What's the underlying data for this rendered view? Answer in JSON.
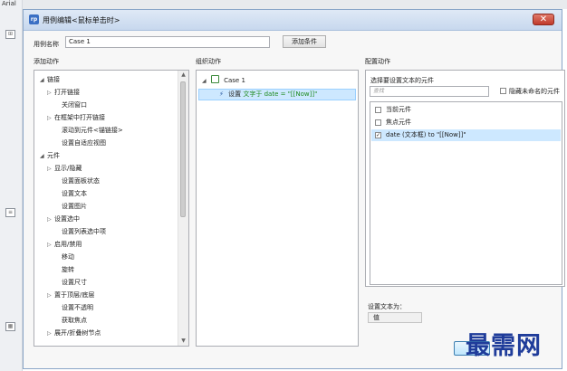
{
  "background": {
    "font_label": "Arial"
  },
  "dialog": {
    "title": "用例编辑<鼠标单击时>",
    "close_symbol": "✕",
    "case_name_label": "用例名称",
    "case_name_value": "Case 1",
    "add_condition_button": "添加条件"
  },
  "sections": {
    "add_action": "添加动作",
    "organize_actions": "组织动作",
    "configure_actions": "配置动作"
  },
  "action_tree": [
    {
      "label": "链接",
      "arrow": "◢",
      "indent": 0
    },
    {
      "label": "打开链接",
      "arrow": "▷",
      "indent": 1
    },
    {
      "label": "关闭窗口",
      "arrow": "",
      "indent": 1
    },
    {
      "label": "在框架中打开链接",
      "arrow": "▷",
      "indent": 1
    },
    {
      "label": "滚动到元件<锚链接>",
      "arrow": "",
      "indent": 1
    },
    {
      "label": "设置自适应视图",
      "arrow": "",
      "indent": 1
    },
    {
      "label": "元件",
      "arrow": "◢",
      "indent": 0
    },
    {
      "label": "显示/隐藏",
      "arrow": "▷",
      "indent": 1
    },
    {
      "label": "设置面板状态",
      "arrow": "",
      "indent": 1
    },
    {
      "label": "设置文本",
      "arrow": "",
      "indent": 1
    },
    {
      "label": "设置图片",
      "arrow": "",
      "indent": 1
    },
    {
      "label": "设置选中",
      "arrow": "▷",
      "indent": 1
    },
    {
      "label": "设置列表选中项",
      "arrow": "",
      "indent": 1
    },
    {
      "label": "启用/禁用",
      "arrow": "▷",
      "indent": 1
    },
    {
      "label": "移动",
      "arrow": "",
      "indent": 1
    },
    {
      "label": "旋转",
      "arrow": "",
      "indent": 1
    },
    {
      "label": "设置尺寸",
      "arrow": "",
      "indent": 1
    },
    {
      "label": "置于顶层/底层",
      "arrow": "▷",
      "indent": 1
    },
    {
      "label": "设置不透明",
      "arrow": "",
      "indent": 1
    },
    {
      "label": "获取焦点",
      "arrow": "",
      "indent": 1
    },
    {
      "label": "展开/折叠树节点",
      "arrow": "▷",
      "indent": 1
    }
  ],
  "organize": {
    "case_arrow": "◢",
    "case_label": "Case 1",
    "action_prefix": "设置",
    "action_text": "文字于 date = \"[[Now]]\""
  },
  "configure": {
    "select_label": "选择要设置文本的元件",
    "search_placeholder": "查找",
    "hide_unnamed": "隐藏未命名的元件",
    "widgets": [
      {
        "label": "当前元件",
        "checked": false,
        "selected": false
      },
      {
        "label": "焦点元件",
        "checked": false,
        "selected": false
      },
      {
        "label": "date (文本框) to \"[[Now]]\"",
        "checked": true,
        "selected": true
      }
    ],
    "set_text_label": "设置文本为：",
    "value_type": "值"
  },
  "watermark": "最需网"
}
